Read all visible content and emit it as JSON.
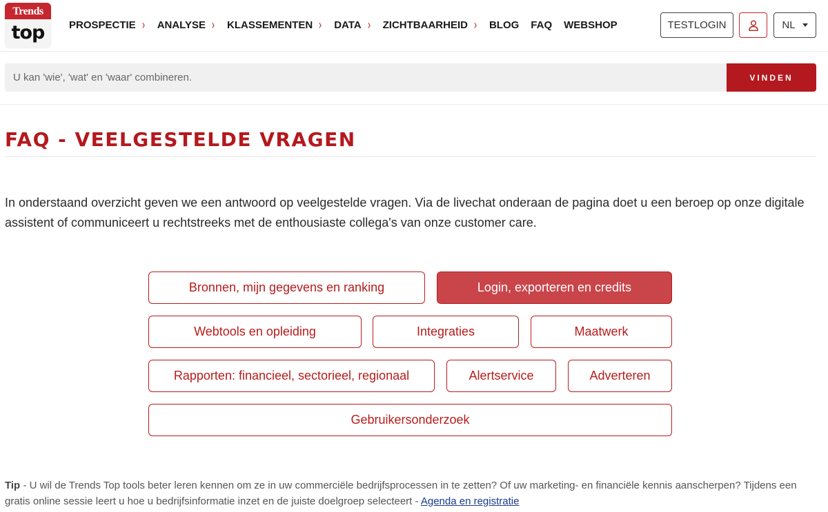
{
  "logo": {
    "top_text": "Trends",
    "bottom_text": "top"
  },
  "nav": {
    "items": [
      {
        "label": "PROSPECTIE",
        "has_submenu": true
      },
      {
        "label": "ANALYSE",
        "has_submenu": true
      },
      {
        "label": "KLASSEMENTEN",
        "has_submenu": true
      },
      {
        "label": "DATA",
        "has_submenu": true
      },
      {
        "label": "ZICHTBAARHEID",
        "has_submenu": true
      },
      {
        "label": "BLOG",
        "has_submenu": false
      },
      {
        "label": "FAQ",
        "has_submenu": false
      },
      {
        "label": "WEBSHOP",
        "has_submenu": false
      }
    ],
    "submenu_chevron": "›"
  },
  "header_actions": {
    "testlogin_label": "TESTLOGIN",
    "user_icon": "user-icon",
    "language": "NL"
  },
  "search": {
    "placeholder": "U kan 'wie', 'wat' en 'waar' combineren.",
    "value": "",
    "button_label": "VINDEN"
  },
  "page": {
    "title": "FAQ - VEELGESTELDE VRAGEN",
    "intro": "In onderstaand overzicht geven we een antwoord op veelgestelde vragen. Via de livechat onderaan de pagina doet u een beroep op onze digitale assistent of communiceert u rechtstreeks met de enthousiaste collega's van onze customer care."
  },
  "categories": [
    {
      "label": "Bronnen, mijn gegevens en ranking",
      "active": false
    },
    {
      "label": "Login, exporteren en credits",
      "active": true
    },
    {
      "label": "Webtools en opleiding",
      "active": false
    },
    {
      "label": "Integraties",
      "active": false
    },
    {
      "label": "Maatwerk",
      "active": false
    },
    {
      "label": "Rapporten: financieel, sectorieel, regionaal",
      "active": false
    },
    {
      "label": "Alertservice",
      "active": false
    },
    {
      "label": "Adverteren",
      "active": false
    },
    {
      "label": "Gebruikersonderzoek",
      "active": false
    }
  ],
  "tip": {
    "label": "Tip",
    "text": " - U wil de Trends Top tools beter leren kennen om ze in uw commerciële bedrijfsprocessen in te zetten? Of uw marketing- en financiële kennis aanscherpen? Tijdens een gratis online sessie leert u hoe u bedrijfsinformatie inzet en de juiste doelgroep selecteert - ",
    "link_text": "Agenda en registratie"
  },
  "colors": {
    "brand_red": "#b3191e",
    "active_category_bg": "#c9454a",
    "search_bg": "#f0f0f0",
    "link_blue": "#1a3a8f"
  }
}
